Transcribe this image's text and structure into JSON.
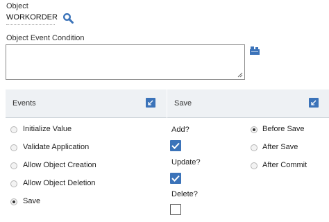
{
  "object": {
    "label": "Object",
    "value": "WORKORDER"
  },
  "event_condition": {
    "label": "Object Event Condition",
    "value": ""
  },
  "events_panel": {
    "title": "Events",
    "options": [
      {
        "label": "Initialize Value",
        "selected": false
      },
      {
        "label": "Validate Application",
        "selected": false
      },
      {
        "label": "Allow Object Creation",
        "selected": false
      },
      {
        "label": "Allow Object Deletion",
        "selected": false
      },
      {
        "label": "Save",
        "selected": true
      }
    ]
  },
  "save_panel": {
    "title": "Save",
    "checks": [
      {
        "label": "Add?",
        "checked": true
      },
      {
        "label": "Update?",
        "checked": true
      },
      {
        "label": "Delete?",
        "checked": false
      }
    ],
    "timing": [
      {
        "label": "Before Save",
        "selected": true
      },
      {
        "label": "After Save",
        "selected": false
      },
      {
        "label": "After Commit",
        "selected": false
      }
    ]
  },
  "colors": {
    "accent": "#3b73b9",
    "header_bg": "#eef1f4"
  },
  "icons": {
    "lookup": "magnifier-icon",
    "builder": "expression-builder-icon",
    "collapse": "collapse-icon"
  }
}
